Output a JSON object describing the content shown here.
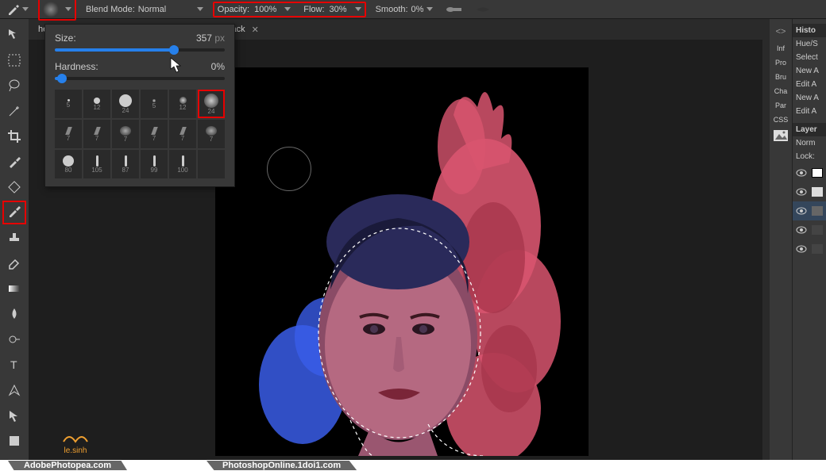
{
  "topbar": {
    "brush_size_preview": "357",
    "blend_mode_label": "Blend Mode:",
    "blend_mode_value": "Normal",
    "opacity_label": "Opacity:",
    "opacity_value": "100%",
    "flow_label": "Flow:",
    "flow_value": "30%",
    "smooth_label": "Smooth:",
    "smooth_value": "0%"
  },
  "tabs": {
    "tab1_prefix": "he",
    "tab2_label": "t-black",
    "close_glyph": "✕"
  },
  "brush_panel": {
    "size_label": "Size:",
    "size_value": "357",
    "size_unit": "px",
    "hardness_label": "Hardness:",
    "hardness_value": "0%",
    "presets": [
      {
        "label": "5"
      },
      {
        "label": "12"
      },
      {
        "label": "24"
      },
      {
        "label": "5"
      },
      {
        "label": "12"
      },
      {
        "label": "24"
      },
      {
        "label": "7"
      },
      {
        "label": "7"
      },
      {
        "label": "7"
      },
      {
        "label": "7"
      },
      {
        "label": "7"
      },
      {
        "label": "7"
      },
      {
        "label": "80"
      },
      {
        "label": "105"
      },
      {
        "label": "87"
      },
      {
        "label": "99"
      },
      {
        "label": "100"
      },
      {
        "label": ""
      }
    ]
  },
  "right": {
    "icons": [
      "Inf",
      "Pro",
      "Bru",
      "Cha",
      "Par",
      "CSS"
    ],
    "history_header": "Histo",
    "history_items": [
      "Hue/S",
      "Select",
      "New A",
      "Edit A",
      "New A",
      "Edit A"
    ],
    "layers_header": "Layer",
    "blend": "Norm",
    "lock_label": "Lock:"
  },
  "bottom": {
    "site1": "AdobePhotopea.com",
    "site2": "PhotoshopOnline.1doi1.com"
  },
  "watermark": "le.sinh",
  "nav_glyph": "<>"
}
